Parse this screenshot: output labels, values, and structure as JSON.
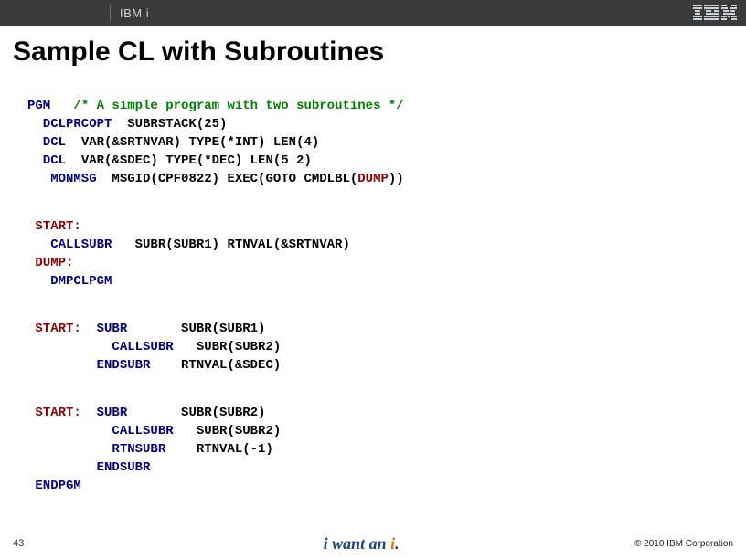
{
  "header": {
    "brand": "IBM i",
    "logo_name": "ibm-logo"
  },
  "title": "Sample CL with Subroutines",
  "code": {
    "l1": {
      "kw": "PGM",
      "cm": "   /* A simple program with two subroutines */"
    },
    "l2": {
      "kw": "  DCLPRCOPT",
      "rest": "  SUBRSTACK(25)"
    },
    "l3": {
      "kw": "  DCL",
      "rest": "  VAR(&SRTNVAR) TYPE(*INT) LEN(4)"
    },
    "l4": {
      "kw": "  DCL",
      "rest": "  VAR(&SDEC) TYPE(*DEC) LEN(5 2)"
    },
    "l5": {
      "kw": "   MONMSG",
      "rest1": "  MSGID(CPF0822) EXEC(GOTO CMDLBL(",
      "dump": "DUMP",
      "rest2": "))"
    },
    "l6": {
      "lbl": " START:"
    },
    "l7": {
      "kw": "   CALLSUBR",
      "rest": "   SUBR(SUBR1) RTNVAL(&SRTNVAR)"
    },
    "l8": {
      "lbl": " DUMP:"
    },
    "l9": {
      "kw": "   DMPCLPGM"
    },
    "l10": {
      "lbl": " START:",
      "kw": "  SUBR",
      "rest": "       SUBR(SUBR1)"
    },
    "l11": {
      "kw": "           CALLSUBR",
      "rest": "   SUBR(SUBR2)"
    },
    "l12": {
      "kw": "         ENDSUBR",
      "rest": "    RTNVAL(&SDEC)"
    },
    "l13": {
      "lbl": " START:",
      "kw": "  SUBR",
      "rest": "       SUBR(SUBR2)"
    },
    "l14": {
      "kw": "           CALLSUBR",
      "rest": "   SUBR(SUBR2)"
    },
    "l15": {
      "kw": "           RTNSUBR",
      "rest": "    RTNVAL(-1)"
    },
    "l16": {
      "kw": "         ENDSUBR"
    },
    "l17": {
      "kw": " ENDPGM"
    }
  },
  "footer": {
    "page": "43",
    "tagline_part1": "i want an ",
    "tagline_accent": "i",
    "tagline_part2": ".",
    "copyright": "© 2010 IBM Corporation"
  }
}
